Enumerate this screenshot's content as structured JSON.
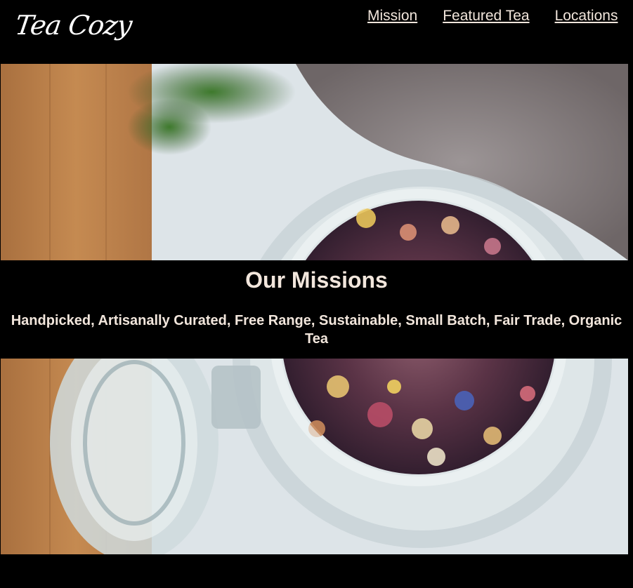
{
  "brand": {
    "logo_text": "Tea Cozy"
  },
  "nav": {
    "items": [
      {
        "label": "Mission"
      },
      {
        "label": "Featured Tea"
      },
      {
        "label": "Locations"
      }
    ]
  },
  "mission": {
    "title": "Our Missions",
    "text": "Handpicked, Artisanally Curated, Free Range, Sustainable, Small Batch, Fair Trade, Organic Tea"
  },
  "colors": {
    "background": "#000000",
    "text_accent": "#f2e6dc",
    "logo": "#ffffff"
  },
  "hero": {
    "image_subject": "glass jar of loose leaf tea with dried petals on a table"
  }
}
